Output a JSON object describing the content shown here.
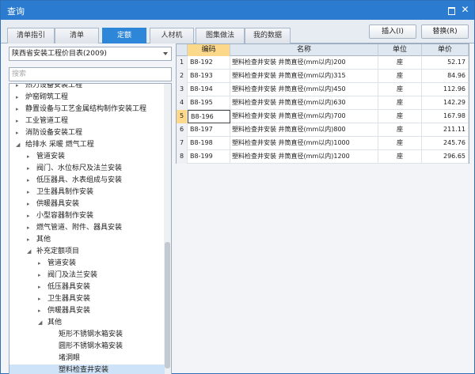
{
  "window": {
    "title": "查询"
  },
  "tabs": [
    {
      "label": "清单指引",
      "active": false
    },
    {
      "label": "清单",
      "active": false
    },
    {
      "label": "定额",
      "active": true
    },
    {
      "label": "人材机",
      "active": false
    },
    {
      "label": "图集做法",
      "active": false
    },
    {
      "label": "我的数据",
      "active": false
    }
  ],
  "actions": {
    "insert_label": "插入(I)",
    "replace_label": "替换(R)"
  },
  "library": {
    "selected": "陕西省安装工程价目表(2009)"
  },
  "search": {
    "placeholder": "搜索"
  },
  "tree": [
    {
      "label": "热力设备安装工程",
      "level": 0,
      "state": "collapsed"
    },
    {
      "label": "炉窑砌筑工程",
      "level": 0,
      "state": "collapsed"
    },
    {
      "label": "静置设备与工艺金属结构制作安装工程",
      "level": 0,
      "state": "collapsed"
    },
    {
      "label": "工业管道工程",
      "level": 0,
      "state": "collapsed"
    },
    {
      "label": "消防设备安装工程",
      "level": 0,
      "state": "collapsed"
    },
    {
      "label": "给排水 采暖 燃气工程",
      "level": 0,
      "state": "expanded"
    },
    {
      "label": "管道安装",
      "level": 1,
      "state": "collapsed"
    },
    {
      "label": "阀门、水位标尺及法兰安装",
      "level": 1,
      "state": "collapsed"
    },
    {
      "label": "低压器具、水表组成与安装",
      "level": 1,
      "state": "collapsed"
    },
    {
      "label": "卫生器具制作安装",
      "level": 1,
      "state": "collapsed"
    },
    {
      "label": "供暖器具安装",
      "level": 1,
      "state": "collapsed"
    },
    {
      "label": "小型容器制作安装",
      "level": 1,
      "state": "collapsed"
    },
    {
      "label": "燃气管道、附件、器具安装",
      "level": 1,
      "state": "collapsed"
    },
    {
      "label": "其他",
      "level": 1,
      "state": "collapsed"
    },
    {
      "label": "补充定额项目",
      "level": 1,
      "state": "expanded"
    },
    {
      "label": "管道安装",
      "level": 2,
      "state": "collapsed"
    },
    {
      "label": "阀门及法兰安装",
      "level": 2,
      "state": "collapsed"
    },
    {
      "label": "低压器具安装",
      "level": 2,
      "state": "collapsed"
    },
    {
      "label": "卫生器具安装",
      "level": 2,
      "state": "collapsed"
    },
    {
      "label": "供暖器具安装",
      "level": 2,
      "state": "collapsed"
    },
    {
      "label": "其他",
      "level": 2,
      "state": "expanded"
    },
    {
      "label": "矩形不锈钢水箱安装",
      "level": 3,
      "state": "leaf"
    },
    {
      "label": "圆形不锈钢水箱安装",
      "level": 3,
      "state": "leaf"
    },
    {
      "label": "堵洞眼",
      "level": 3,
      "state": "leaf"
    },
    {
      "label": "塑料检查井安装",
      "level": 3,
      "state": "leaf",
      "selected": true
    }
  ],
  "table": {
    "columns": {
      "code": "编码",
      "name": "名称",
      "unit": "单位",
      "price": "单价"
    },
    "current_row": 5,
    "rows": [
      {
        "n": "1",
        "code": "B8-192",
        "name": "塑料检查井安装 井筒直径(mm以内)200",
        "unit": "座",
        "price": "52.17"
      },
      {
        "n": "2",
        "code": "B8-193",
        "name": "塑料检查井安装 井筒直径(mm以内)315",
        "unit": "座",
        "price": "84.96"
      },
      {
        "n": "3",
        "code": "B8-194",
        "name": "塑料检查井安装 井筒直径(mm以内)450",
        "unit": "座",
        "price": "112.96"
      },
      {
        "n": "4",
        "code": "B8-195",
        "name": "塑料检查井安装 井筒直径(mm以内)630",
        "unit": "座",
        "price": "142.29"
      },
      {
        "n": "5",
        "code": "B8-196",
        "name": "塑料检查井安装 井筒直径(mm以内)700",
        "unit": "座",
        "price": "167.98"
      },
      {
        "n": "6",
        "code": "B8-197",
        "name": "塑料检查井安装 井筒直径(mm以内)800",
        "unit": "座",
        "price": "211.11"
      },
      {
        "n": "7",
        "code": "B8-198",
        "name": "塑料检查井安装 井筒直径(mm以内)1000",
        "unit": "座",
        "price": "245.76"
      },
      {
        "n": "8",
        "code": "B8-199",
        "name": "塑料检查井安装 井筒直径(mm以内)1200",
        "unit": "座",
        "price": "296.65"
      }
    ]
  }
}
